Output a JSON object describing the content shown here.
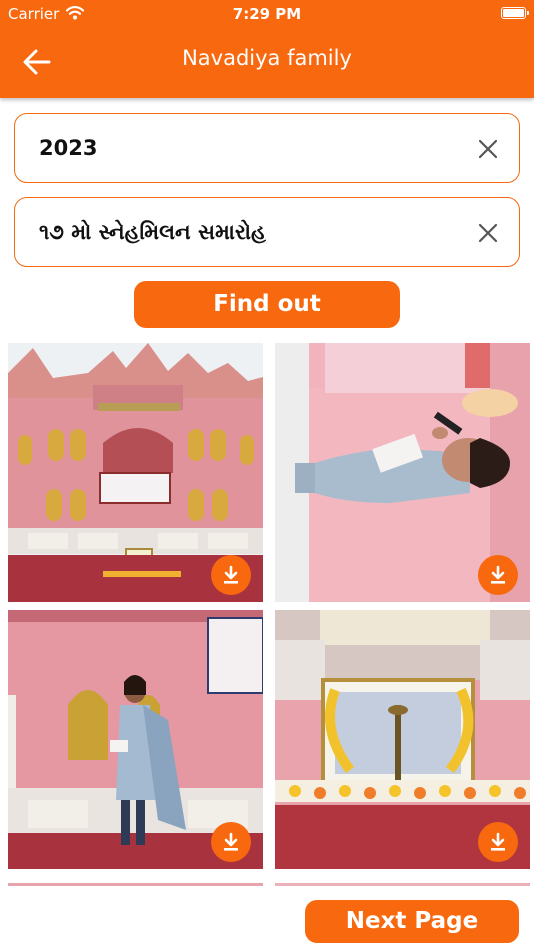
{
  "status_bar": {
    "carrier": "Carrier",
    "time": "7:29 PM"
  },
  "header": {
    "title": "Navadiya family"
  },
  "filters": {
    "year": "2023",
    "event": "૧૭ મો સ્નેહમિલન સમારોહ"
  },
  "buttons": {
    "find_out": "Find out",
    "next_page": "Next Page"
  },
  "colors": {
    "accent": "#f7680f"
  },
  "icons": {
    "back": "arrow-left-icon",
    "clear": "close-icon",
    "download": "download-icon"
  },
  "gallery": {
    "photos": [
      "stage-venue",
      "girl-speaking-microphone",
      "girl-standing-on-stage",
      "framed-portrait-with-lamp"
    ]
  }
}
